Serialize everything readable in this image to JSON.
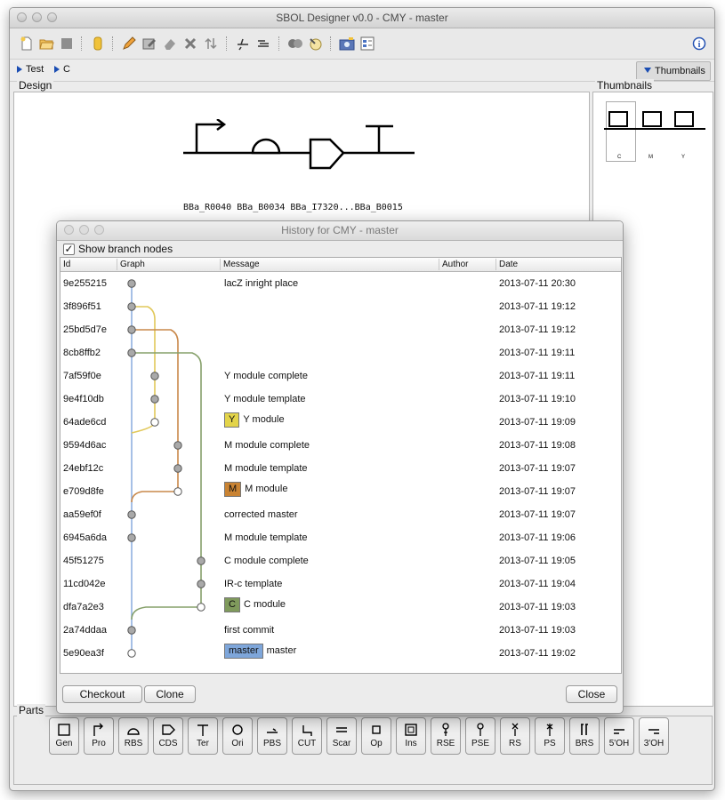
{
  "window": {
    "title": "SBOL Designer v0.0 - CMY - master"
  },
  "toolbar": {
    "icons": [
      "new-icon",
      "open-icon",
      "save-icon",
      "version-icon",
      "edit-icon",
      "edit-tags-icon",
      "erase-icon",
      "delete-icon",
      "flip-icon",
      "focus-in-icon",
      "focus-out-icon",
      "find-parts-icon",
      "upload-icon",
      "snapshot-icon",
      "settings-icon",
      "info-icon"
    ]
  },
  "nav": {
    "crumbs": [
      "Test",
      "C"
    ],
    "thumbnails_label": "Thumbnails"
  },
  "design": {
    "label": "Design",
    "parts_caption": "BBa_R0040  BBa_B0034  BBa_I7320...BBa_B0015"
  },
  "thumbnails": {
    "label": "Thumbnails",
    "captions": [
      "C",
      "M",
      "Y"
    ]
  },
  "parts": {
    "label": "Parts",
    "items": [
      "Gen",
      "Pro",
      "RBS",
      "CDS",
      "Ter",
      "Ori",
      "PBS",
      "CUT",
      "Scar",
      "Op",
      "Ins",
      "RSE",
      "PSE",
      "RS",
      "PS",
      "BRS",
      "5'OH",
      "3'OH"
    ]
  },
  "history": {
    "title": "History for CMY - master",
    "show_branch_nodes": "Show branch nodes",
    "columns": [
      "Id",
      "Graph",
      "Message",
      "Author",
      "Date"
    ],
    "rows": [
      {
        "id": "9e255215",
        "message": "lacZ inright  place",
        "tag": "",
        "author": "",
        "date": "2013-07-11 20:30"
      },
      {
        "id": "3f896f51",
        "message": "",
        "tag": "",
        "author": "",
        "date": "2013-07-11 19:12"
      },
      {
        "id": "25bd5d7e",
        "message": "",
        "tag": "",
        "author": "",
        "date": "2013-07-11 19:12"
      },
      {
        "id": "8cb8ffb2",
        "message": "",
        "tag": "",
        "author": "",
        "date": "2013-07-11 19:11"
      },
      {
        "id": "7af59f0e",
        "message": "Y module complete",
        "tag": "",
        "author": "",
        "date": "2013-07-11 19:11"
      },
      {
        "id": "9e4f10db",
        "message": "Y module template",
        "tag": "",
        "author": "",
        "date": "2013-07-11 19:10"
      },
      {
        "id": "64ade6cd",
        "message": "Y module",
        "tag": "Y",
        "tag_color": "#e3d44a",
        "author": "",
        "date": "2013-07-11 19:09"
      },
      {
        "id": "9594d6ac",
        "message": "M module complete",
        "tag": "",
        "author": "",
        "date": "2013-07-11 19:08"
      },
      {
        "id": "24ebf12c",
        "message": "M module template",
        "tag": "",
        "author": "",
        "date": "2013-07-11 19:07"
      },
      {
        "id": "e709d8fe",
        "message": "M module",
        "tag": "M",
        "tag_color": "#c98333",
        "author": "",
        "date": "2013-07-11 19:07"
      },
      {
        "id": "aa59ef0f",
        "message": "corrected master",
        "tag": "",
        "author": "",
        "date": "2013-07-11 19:07"
      },
      {
        "id": "6945a6da",
        "message": "M module template",
        "tag": "",
        "author": "",
        "date": "2013-07-11 19:06"
      },
      {
        "id": "45f51275",
        "message": "C module complete",
        "tag": "",
        "author": "",
        "date": "2013-07-11 19:05"
      },
      {
        "id": "11cd042e",
        "message": "IR-c template",
        "tag": "",
        "author": "",
        "date": "2013-07-11 19:04"
      },
      {
        "id": "dfa7a2e3",
        "message": "C module",
        "tag": "C",
        "tag_color": "#7f9a5c",
        "author": "",
        "date": "2013-07-11 19:03"
      },
      {
        "id": "2a74ddaa",
        "message": "first commit",
        "tag": "",
        "author": "",
        "date": "2013-07-11 19:03"
      },
      {
        "id": "5e90ea3f",
        "message": "master",
        "tag": "master",
        "tag_color": "#7ea6da",
        "author": "",
        "date": "2013-07-11 19:02"
      }
    ],
    "branch_colors": {
      "master": "#8fb0df",
      "y": "#e1c85a",
      "m": "#c9884a",
      "c": "#86a06a"
    },
    "buttons": {
      "checkout": "Checkout",
      "clone": "Clone",
      "close": "Close"
    }
  }
}
